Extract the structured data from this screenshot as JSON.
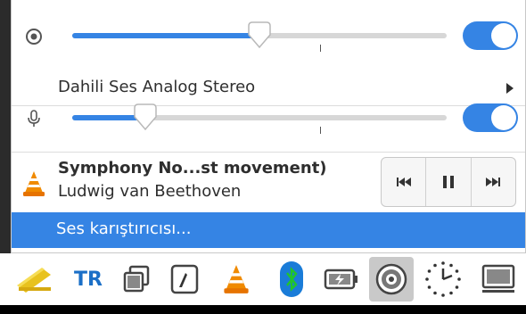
{
  "output_volume": {
    "level": 0.5,
    "enabled": true
  },
  "output_device": {
    "label": "Dahili Ses Analog Stereo"
  },
  "input_volume": {
    "level": 0.2,
    "enabled": true
  },
  "media_player": {
    "title": "Symphony No...st movement)",
    "artist": "Ludwig van Beethoven"
  },
  "mixer": {
    "label": "Ses karıştırıcısı..."
  },
  "panel": {
    "keyboard_layout": "TR"
  },
  "colors": {
    "accent": "#3584e4",
    "tr_blue": "#1b6fc7",
    "bluetooth": "#1a7cd8"
  }
}
